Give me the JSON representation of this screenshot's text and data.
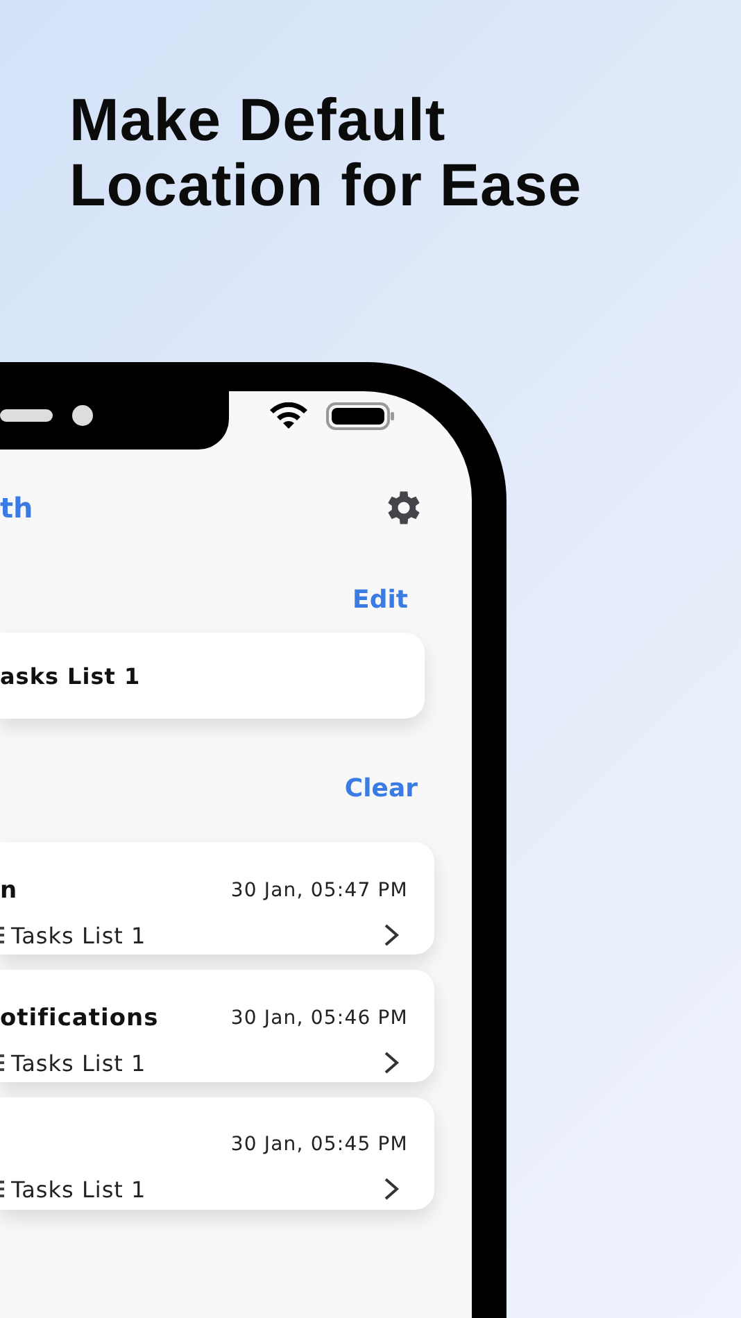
{
  "headline": [
    "Make Default",
    "Location for Ease"
  ],
  "header": {
    "title": "th"
  },
  "default_section": {
    "action": "Edit",
    "item": "asks List 1"
  },
  "recent_section": {
    "action": "Clear",
    "items": [
      {
        "title": "n",
        "time": "30 Jan, 05:47 PM",
        "list": "Tasks List 1"
      },
      {
        "title": "otifications",
        "time": "30 Jan, 05:46 PM",
        "list": "Tasks List 1"
      },
      {
        "time": "30 Jan, 05:45 PM",
        "list": "Tasks List 1"
      }
    ]
  }
}
